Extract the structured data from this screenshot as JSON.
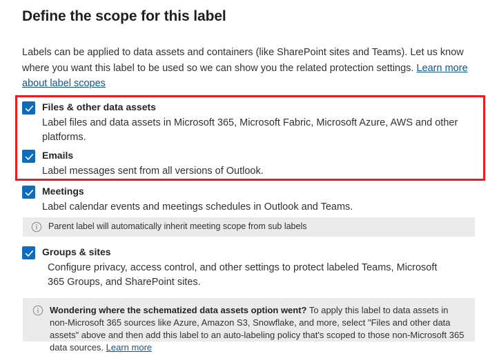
{
  "page": {
    "title": "Define the scope for this label",
    "intro_text": "Labels can be applied to data assets and containers (like SharePoint sites and Teams). Let us know where you want this label to be used so we can show you the related protection settings. ",
    "intro_link": "Learn more about label scopes"
  },
  "colors": {
    "checkbox_fill": "#0f6cbd",
    "highlight_border": "#ed1c24",
    "link": "#0f548c",
    "infobar_background": "#ebebeb",
    "heading": "#201f1e"
  },
  "options": [
    {
      "id": "files",
      "title": "Files & other data assets",
      "description": "Label files and data assets in Microsoft 365, Microsoft Fabric, Microsoft Azure, AWS and other platforms.",
      "checked": true
    },
    {
      "id": "emails",
      "title": "Emails",
      "description": "Label messages sent from all versions of Outlook.",
      "checked": true
    },
    {
      "id": "meetings",
      "title": "Meetings",
      "description": "Label calendar events and meetings schedules in Outlook and Teams.",
      "checked": true
    },
    {
      "id": "groups",
      "title": "Groups & sites",
      "description": "Configure privacy, access control, and other settings to protect labeled Teams, Microsoft 365 Groups, and SharePoint sites.",
      "checked": true
    }
  ],
  "infobars": {
    "meetings": {
      "icon": "info-icon",
      "text": "Parent label will automatically inherit meeting scope from sub labels"
    },
    "schematized": {
      "icon": "info-icon",
      "bold_lead": "Wondering where the schematized data assets option went?",
      "body": " To apply this label to data assets in non-Microsoft 365 sources like Azure, Amazon S3, Snowflake, and more, select \"Files and other data assets\" above and then add this label to an auto-labeling policy that's scoped to those non-Microsoft 365 data sources. ",
      "link": "Learn more"
    }
  }
}
